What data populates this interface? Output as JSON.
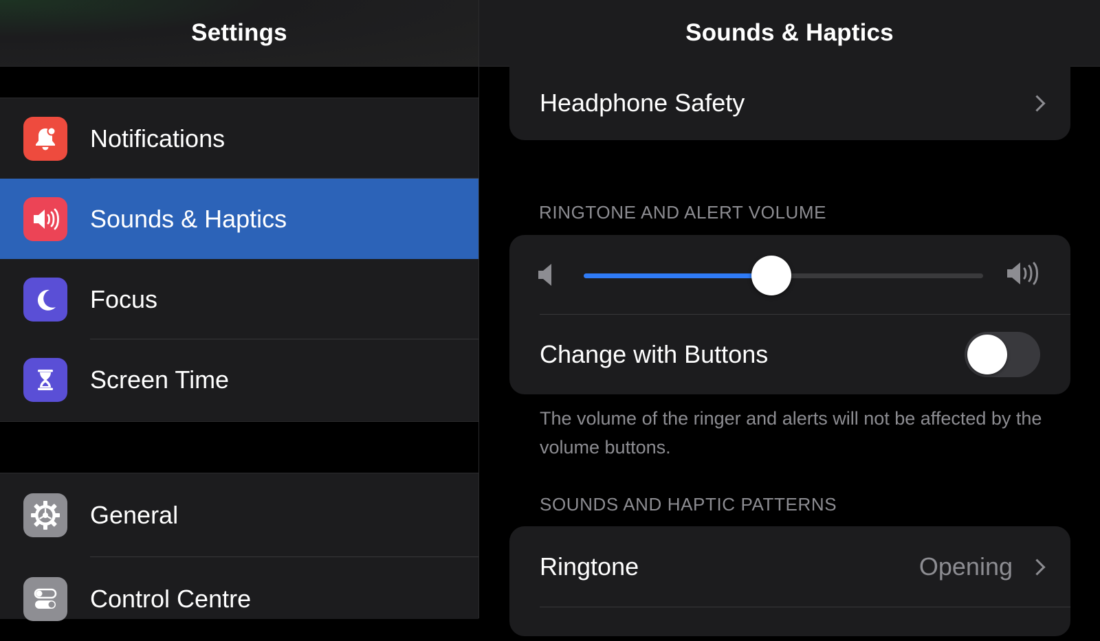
{
  "sidebar": {
    "title": "Settings",
    "items": [
      {
        "label": "Notifications",
        "icon": "bell-icon",
        "color": "#ee4b3e"
      },
      {
        "label": "Sounds & Haptics",
        "icon": "speaker-icon",
        "color": "#ec4456",
        "selected": true
      },
      {
        "label": "Focus",
        "icon": "moon-icon",
        "color": "#5a4fd6"
      },
      {
        "label": "Screen Time",
        "icon": "hourglass-icon",
        "color": "#5a4fd6"
      },
      {
        "label": "General",
        "icon": "gear-icon",
        "color": "#8e8e93"
      },
      {
        "label": "Control Centre",
        "icon": "toggles-icon",
        "color": "#8e8e93"
      }
    ],
    "selected_color": "#2c63b8"
  },
  "main": {
    "title": "Sounds & Haptics",
    "headphone_safety": {
      "label": "Headphone Safety"
    },
    "ringtone_section": {
      "header": "RINGTONE AND ALERT VOLUME",
      "volume_level": 0.47,
      "change_with_buttons": {
        "label": "Change with Buttons",
        "on": false
      },
      "footnote": "The volume of the ringer and alerts will not be affected by the volume buttons."
    },
    "patterns_section": {
      "header": "SOUNDS AND HAPTIC PATTERNS",
      "ringtone": {
        "label": "Ringtone",
        "value": "Opening"
      }
    },
    "accent_color": "#2f7bf6"
  }
}
